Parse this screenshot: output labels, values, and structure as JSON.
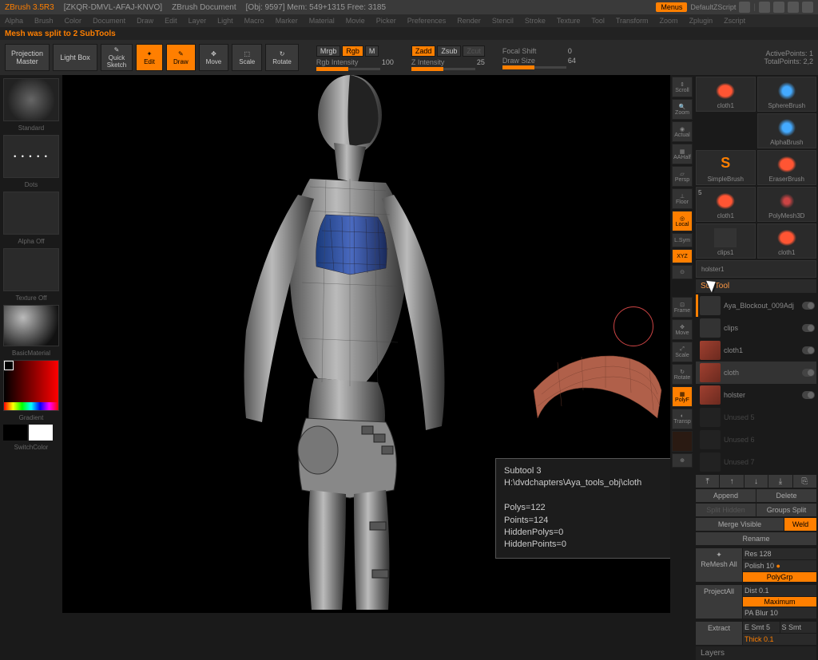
{
  "title": {
    "app": "ZBrush 3.5R3",
    "project": "[ZKQR-DMVL-AFAJ-KNVO]",
    "document": "ZBrush Document",
    "stats": "[Obj: 9597]  Mem: 549+1315  Free: 3185",
    "menus": "Menus",
    "script": "DefaultZScript"
  },
  "menu": [
    "Alpha",
    "Brush",
    "Color",
    "Document",
    "Draw",
    "Edit",
    "Layer",
    "Light",
    "Macro",
    "Marker",
    "Material",
    "Movie",
    "Picker",
    "Preferences",
    "Render",
    "Stencil",
    "Stroke",
    "Texture",
    "Tool",
    "Transform",
    "Zoom",
    "Zplugin",
    "Zscript"
  ],
  "status": "Mesh was split to 2 SubTools",
  "toolbar": {
    "projection": "Projection Master",
    "lightbox": "Light Box",
    "quicksketch": "Quick Sketch",
    "edit": "Edit",
    "draw": "Draw",
    "move": "Move",
    "scale": "Scale",
    "rotate": "Rotate",
    "mrgb": "Mrgb",
    "rgb": "Rgb",
    "m": "M",
    "rgbint_label": "Rgb Intensity",
    "rgbint_val": "100",
    "zadd": "Zadd",
    "zsub": "Zsub",
    "zcut": "Zcut",
    "zint_label": "Z Intensity",
    "zint_val": "25",
    "focal_label": "Focal Shift",
    "focal_val": "0",
    "drawsize_label": "Draw Size",
    "drawsize_val": "64",
    "active_label": "ActivePoints:",
    "active_val": "1",
    "total_label": "TotalPoints:",
    "total_val": "2,2"
  },
  "left": {
    "standard": "Standard",
    "dots": "Dots",
    "alphaoff": "Alpha Off",
    "textureoff": "Texture Off",
    "basicmat": "BasicMaterial",
    "gradient": "Gradient",
    "switchcolor": "SwitchColor"
  },
  "righticons": {
    "scroll": "Scroll",
    "zoom": "Zoom",
    "actual": "Actual",
    "aahalf": "AAHalf",
    "persp": "Persp",
    "floor": "Floor",
    "local": "Local",
    "lsym": "L.Sym",
    "xyz": "XYZ",
    "frame": "Frame",
    "move": "Move",
    "scale": "Scale",
    "rotate": "Rotate",
    "polyf": "PolyF",
    "transp": "Transp"
  },
  "brushes": {
    "cloth1a": "cloth1",
    "sphere": "SphereBrush",
    "alpha": "AlphaBrush",
    "simple": "SimpleBrush",
    "eraser": "EraserBrush",
    "cloth1b": "cloth1",
    "polymesh": "PolyMesh3D",
    "clips1": "clips1",
    "cloth1c": "cloth1",
    "holster1": "holster1",
    "count": "5"
  },
  "subtool": {
    "title": "SubTool",
    "items": [
      "Aya_Blockout_009Adj",
      "clips",
      "cloth1",
      "cloth",
      "holster",
      "Unused 5",
      "Unused 6",
      "Unused 7"
    ],
    "append": "Append",
    "delete": "Delete",
    "splithidden": "Split Hidden",
    "groupssplit": "Groups Split",
    "mergevisible": "Merge Visible",
    "weld": "Weld",
    "rename": "Rename",
    "remesh": "ReMesh All",
    "res": "Res 128",
    "polish": "Polish 10",
    "polygrp": "PolyGrp",
    "projectall": "ProjectAll",
    "dist": "Dist 0.1",
    "maximum": "Maximum",
    "pablur": "PA Blur 10",
    "extract": "Extract",
    "esmt": "E Smt 5",
    "ssmt": "S Smt",
    "thick": "Thick 0.1",
    "layers": "Layers"
  },
  "tooltip": {
    "l1": "Subtool 3",
    "l2": "H:\\dvdchapters\\Aya_tools_obj\\cloth",
    "l3": "Polys=122",
    "l4": "Points=124",
    "l5": "HiddenPolys=0",
    "l6": "HiddenPoints=0"
  }
}
